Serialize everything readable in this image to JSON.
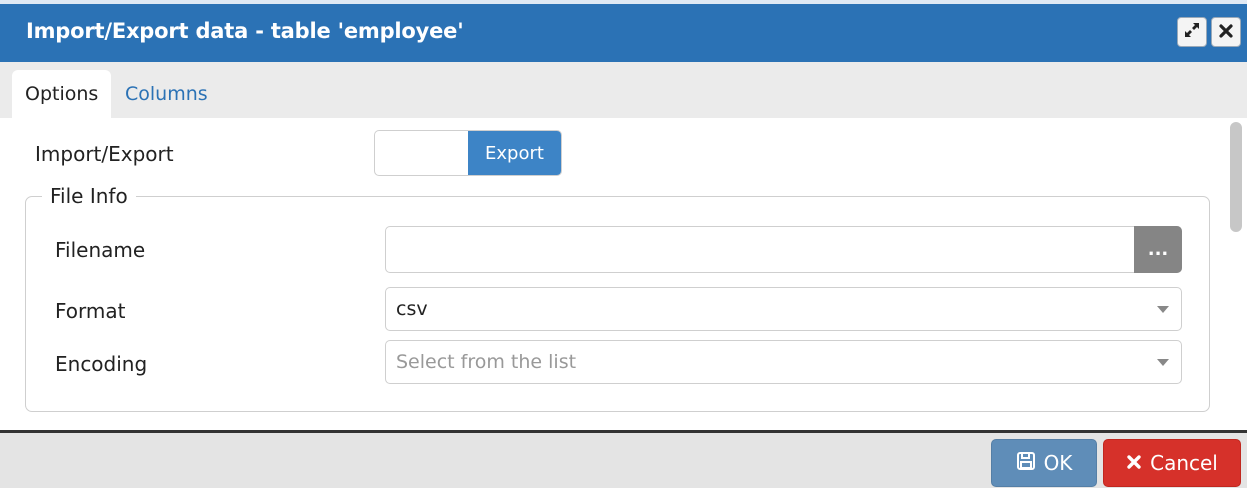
{
  "dialog": {
    "title": "Import/Export data - table 'employee'",
    "maximize_icon": "expand-icon",
    "close_icon": "close-icon"
  },
  "tabs": [
    {
      "label": "Options",
      "active": true
    },
    {
      "label": "Columns",
      "active": false
    }
  ],
  "options": {
    "import_export_label": "Import/Export",
    "import_export_value": "Export",
    "file_info": {
      "legend": "File Info",
      "filename_label": "Filename",
      "filename_value": "",
      "browse_label": "...",
      "format_label": "Format",
      "format_value": "csv",
      "encoding_label": "Encoding",
      "encoding_placeholder": "Select from the list"
    }
  },
  "footer": {
    "ok_label": "OK",
    "cancel_label": "Cancel"
  },
  "colors": {
    "title_bar": "#2b72b5",
    "toggle_on": "#3d84c6",
    "ok_button": "#5f8db8",
    "cancel_button": "#d6312a"
  }
}
